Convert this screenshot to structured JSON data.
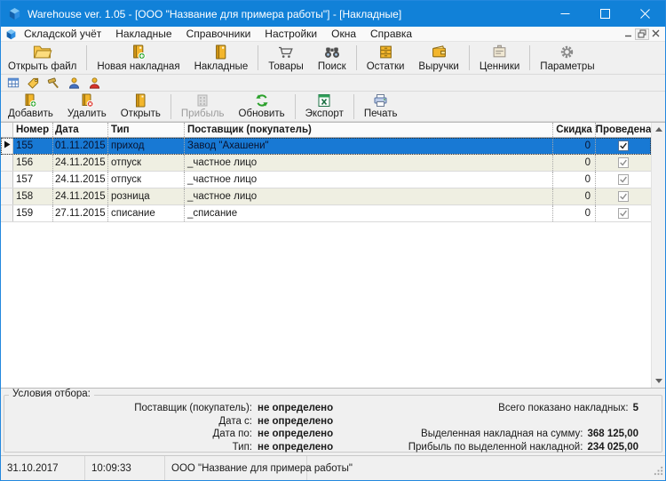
{
  "window": {
    "title": "Warehouse ver. 1.05 - [ООО \"Название для примера работы\"] - [Накладные]"
  },
  "menu": {
    "items": [
      "Складской учёт",
      "Накладные",
      "Справочники",
      "Настройки",
      "Окна",
      "Справка"
    ]
  },
  "main_toolbar": {
    "buttons": [
      {
        "label": "Открыть файл",
        "icon": "open-file-icon"
      },
      {
        "label": "Новая накладная",
        "icon": "new-invoice-icon"
      },
      {
        "label": "Накладные",
        "icon": "invoices-icon"
      },
      {
        "label": "Товары",
        "icon": "goods-cart-icon"
      },
      {
        "label": "Поиск",
        "icon": "search-binoculars-icon"
      },
      {
        "label": "Остатки",
        "icon": "stock-drawers-icon"
      },
      {
        "label": "Выручки",
        "icon": "revenue-wallet-icon"
      },
      {
        "label": "Ценники",
        "icon": "price-tags-icon"
      },
      {
        "label": "Параметры",
        "icon": "settings-gear-icon"
      }
    ]
  },
  "quick_toolbar": {
    "icons": [
      "table-grid-icon",
      "price-tag-icon",
      "hammer-icon",
      "user-blue-icon",
      "user-red-icon"
    ]
  },
  "actions_toolbar": {
    "buttons": [
      {
        "label": "Добавить",
        "icon": "add-invoice-icon",
        "disabled": false
      },
      {
        "label": "Удалить",
        "icon": "delete-invoice-icon",
        "disabled": false
      },
      {
        "label": "Открыть",
        "icon": "open-invoice-icon",
        "disabled": false
      },
      {
        "label": "Прибыль",
        "icon": "profit-icon",
        "disabled": true
      },
      {
        "label": "Обновить",
        "icon": "refresh-icon",
        "disabled": false
      },
      {
        "label": "Экспорт",
        "icon": "excel-export-icon",
        "disabled": false
      },
      {
        "label": "Печать",
        "icon": "print-icon",
        "disabled": false
      }
    ]
  },
  "grid": {
    "columns": [
      "Номер",
      "Дата",
      "Тип",
      "Поставщик (покупатель)",
      "Скидка",
      "Проведена"
    ],
    "rows": [
      {
        "number": "155",
        "date": "01.11.2015",
        "type": "приход",
        "supplier": "Завод \"Ахашени\"",
        "discount": "0",
        "posted": true,
        "selected": true
      },
      {
        "number": "156",
        "date": "24.11.2015",
        "type": "отпуск",
        "supplier": "_частное лицо",
        "discount": "0",
        "posted": true,
        "selected": false
      },
      {
        "number": "157",
        "date": "24.11.2015",
        "type": "отпуск",
        "supplier": "_частное лицо",
        "discount": "0",
        "posted": true,
        "selected": false
      },
      {
        "number": "158",
        "date": "24.11.2015",
        "type": "розница",
        "supplier": "_частное лицо",
        "discount": "0",
        "posted": true,
        "selected": false
      },
      {
        "number": "159",
        "date": "27.11.2015",
        "type": "списание",
        "supplier": "_списание",
        "discount": "0",
        "posted": true,
        "selected": false
      }
    ]
  },
  "filter_panel": {
    "title": "Условия отбора:",
    "fields": [
      {
        "label": "Поставщик (покупатель):",
        "value": "не определено"
      },
      {
        "label": "Дата с:",
        "value": "не определено"
      },
      {
        "label": "Дата по:",
        "value": "не определено"
      },
      {
        "label": "Тип:",
        "value": "не определено"
      }
    ],
    "summary": [
      {
        "label": "Всего показано накладных:",
        "value": "5"
      },
      {
        "label": "Выделенная накладная на сумму:",
        "value": "368 125,00"
      },
      {
        "label": "Прибыль по выделенной накладной:",
        "value": "234 025,00"
      }
    ]
  },
  "status_bar": {
    "date": "31.10.2017",
    "time": "10:09:33",
    "company": "ООО \"Название для примера работы\""
  },
  "colors": {
    "titlebar": "#1181d8",
    "selection": "#1879d4",
    "row_alt": "#efefe2",
    "toolbar_bg": "#f0f0f0"
  }
}
